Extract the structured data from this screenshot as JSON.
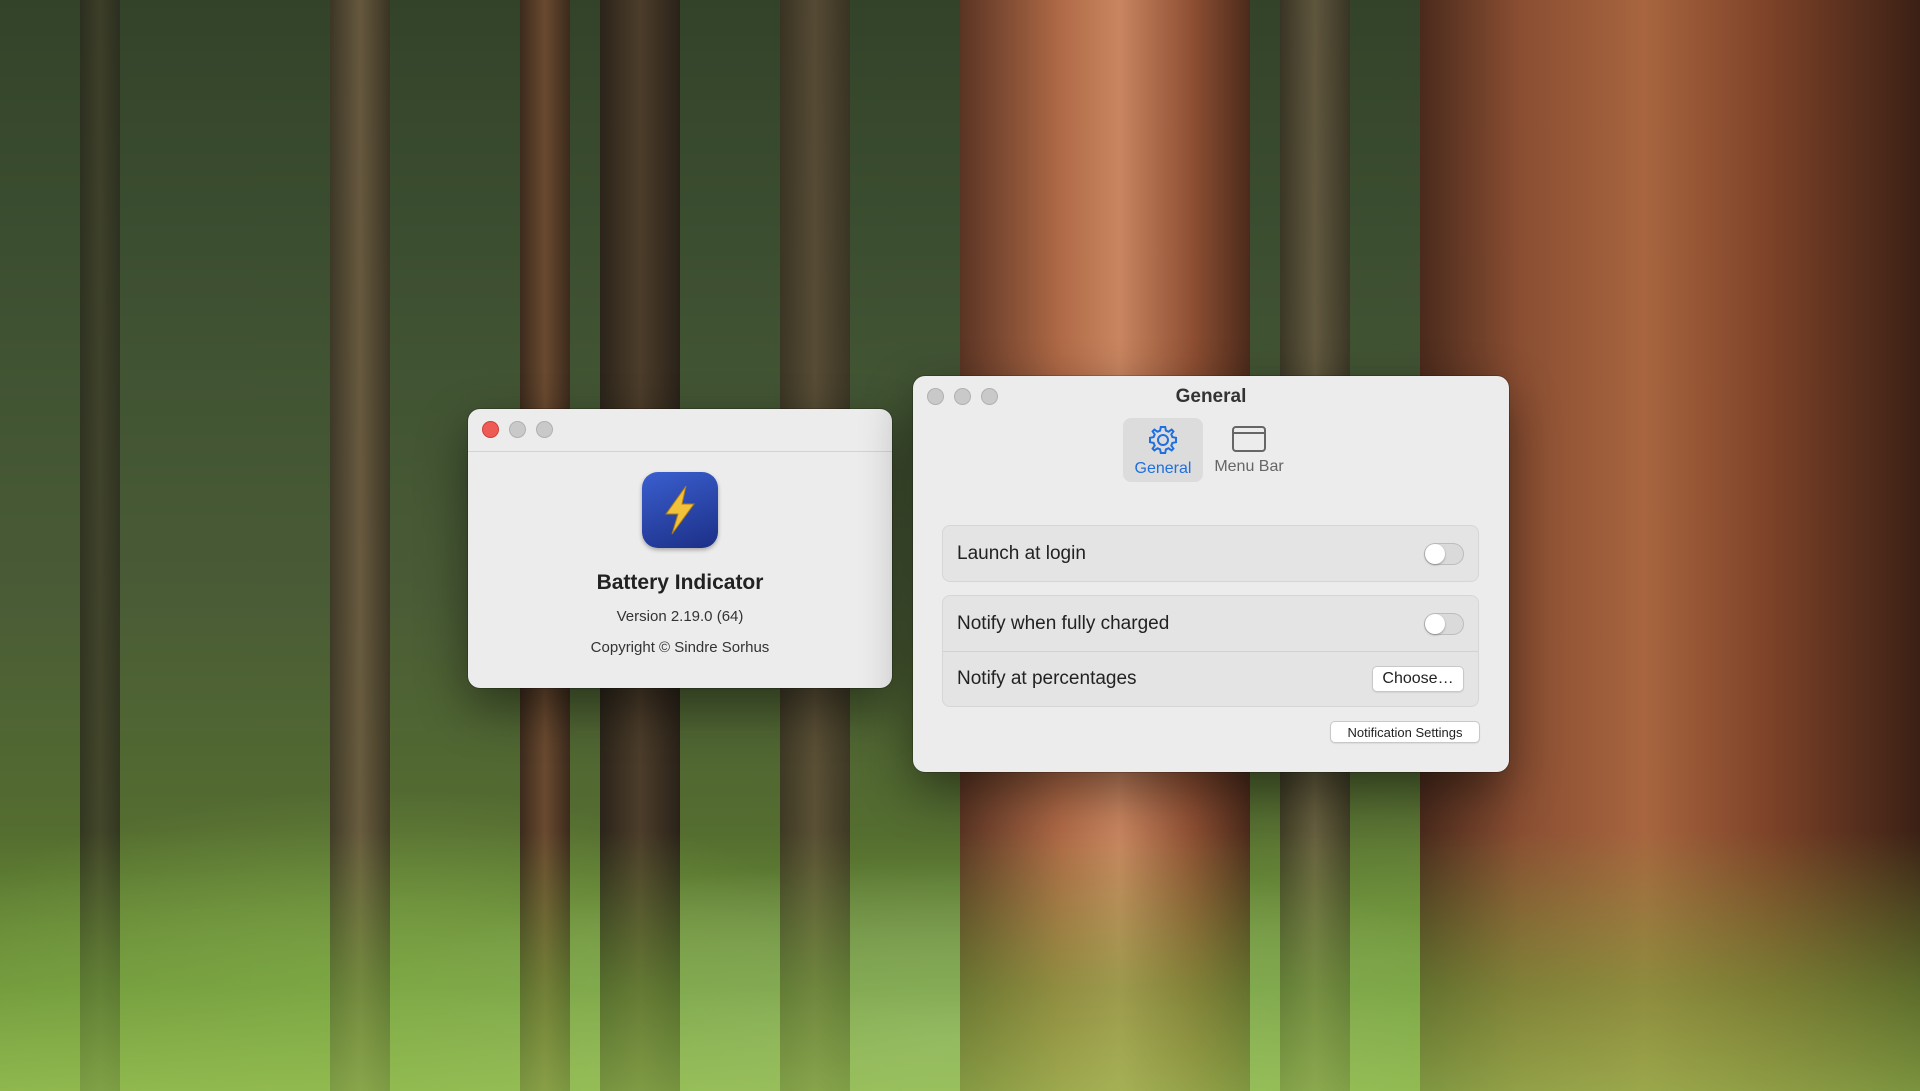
{
  "about_window": {
    "app_name": "Battery Indicator",
    "version": "Version 2.19.0 (64)",
    "copyright": "Copyright © Sindre Sorhus",
    "icon": "battery-lightning-app-icon"
  },
  "settings_window": {
    "title": "General",
    "tabs": [
      {
        "label": "General",
        "icon": "gear-icon",
        "active": true
      },
      {
        "label": "Menu Bar",
        "icon": "menu-bar-icon",
        "active": false
      }
    ],
    "launch_at_login": {
      "label": "Launch at login",
      "enabled": false
    },
    "notify_fully_charged": {
      "label": "Notify when fully charged",
      "enabled": false
    },
    "notify_percentages": {
      "label": "Notify at percentages",
      "button_label": "Choose…"
    },
    "notification_settings_button": "Notification Settings"
  },
  "colors": {
    "close_button": "#ee5b55",
    "accent": "#1f6fe0",
    "app_icon": "#2a47b0",
    "bolt": "#f3c23b"
  }
}
